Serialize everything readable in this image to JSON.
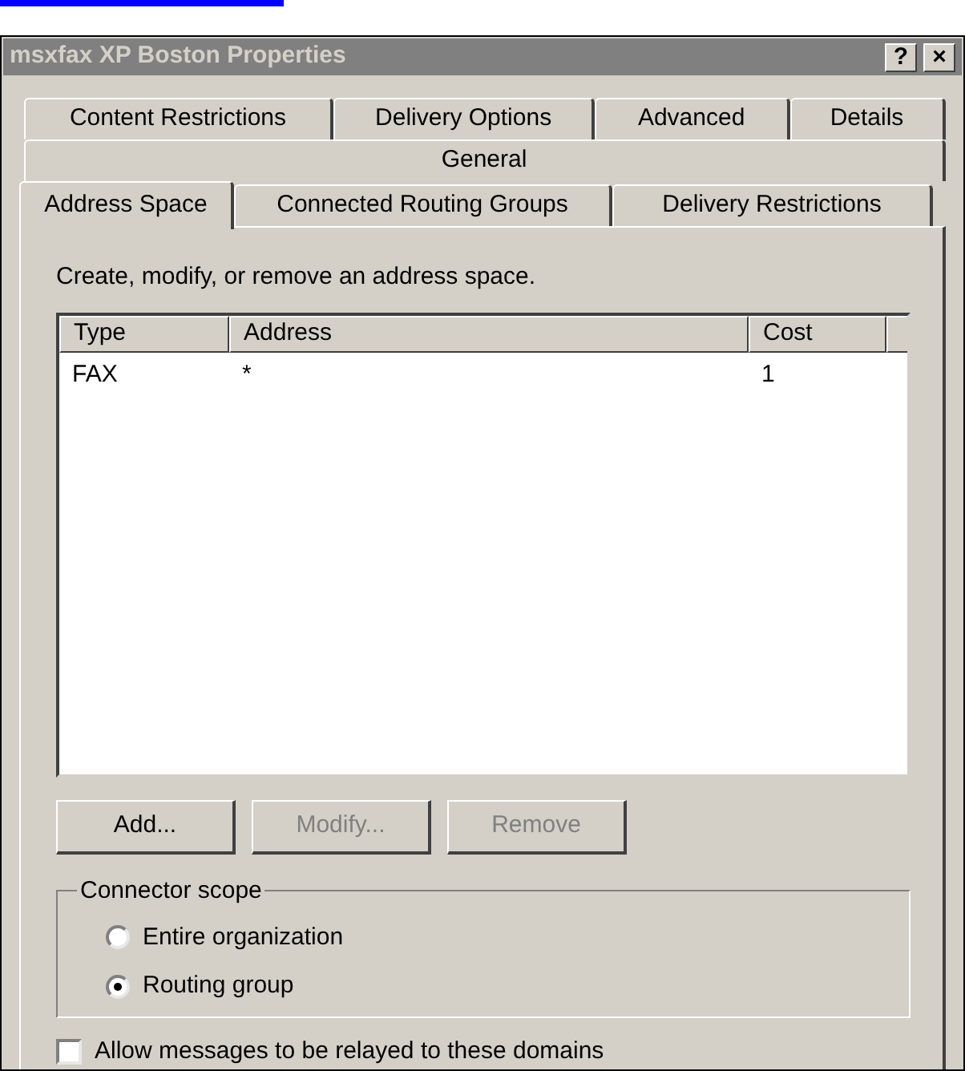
{
  "window": {
    "title": "msxfax XP Boston Properties",
    "controls": [
      "?",
      "×"
    ]
  },
  "tab_rows": [
    [
      {
        "label": "Content Restrictions",
        "selected": false
      },
      {
        "label": "Delivery Options",
        "selected": false
      },
      {
        "label": "Advanced",
        "selected": false
      },
      {
        "label": "Details",
        "selected": false
      }
    ],
    [
      {
        "label": "General",
        "selected": false
      }
    ],
    [
      {
        "label": "Address Space",
        "selected": true
      },
      {
        "label": "Connected Routing Groups",
        "selected": false
      },
      {
        "label": "Delivery Restrictions",
        "selected": false
      }
    ]
  ],
  "description": "Create, modify, or remove an address space.",
  "table": {
    "columns": [
      "Type",
      "Address",
      "Cost"
    ],
    "rows": [
      [
        "FAX",
        "*",
        "1"
      ]
    ]
  },
  "buttons": [
    {
      "label": "Add...",
      "disabled": false
    },
    {
      "label": "Modify...",
      "disabled": true
    },
    {
      "label": "Remove",
      "disabled": true
    }
  ],
  "connector_scope": {
    "title": "Connector scope",
    "options": [
      {
        "label": "Entire organization",
        "selected": false
      },
      {
        "label": "Routing group",
        "selected": true
      }
    ]
  },
  "relay_checkbox": {
    "label": "Allow messages to be relayed to these domains",
    "checked": false
  }
}
